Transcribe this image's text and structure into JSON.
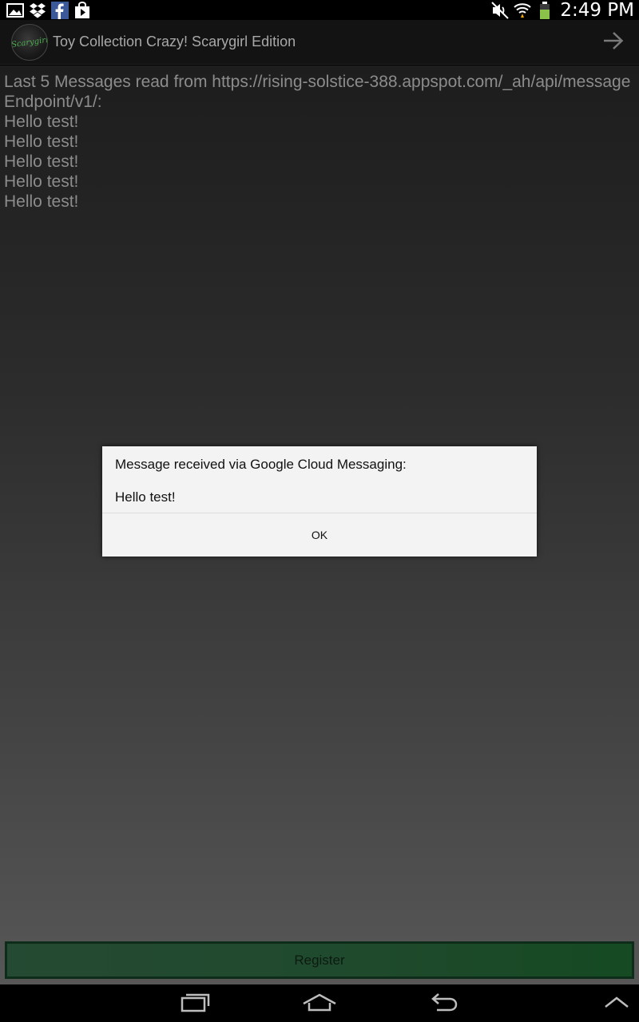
{
  "status_bar": {
    "left_icons": [
      "gallery-icon",
      "dropbox-icon",
      "facebook-icon",
      "play-store-icon"
    ],
    "right_icons": [
      "mute-icon",
      "wifi-icon",
      "battery-icon"
    ],
    "time": "2:49 PM"
  },
  "action_bar": {
    "logo_text": "Scarygirl",
    "title": "Toy Collection Crazy! Scarygirl Edition",
    "forward_icon": "arrow-right-icon"
  },
  "messages": {
    "header": "Last 5 Messages read from https://rising-solstice-388.appspot.com/_ah/api/messageEndpoint/v1/:",
    "items": [
      "Hello test!",
      "Hello test!",
      "Hello test!",
      "Hello test!",
      "Hello test!"
    ]
  },
  "register_button": {
    "label": "Register"
  },
  "dialog": {
    "message": "Message received via Google Cloud Messaging:",
    "body": "Hello test!",
    "ok_label": "OK"
  },
  "nav_bar": {
    "icons": [
      "recent-apps-icon",
      "home-icon",
      "back-icon",
      "menu-up-icon"
    ]
  },
  "colors": {
    "accent_green": "#1f4a2c",
    "dialog_bg": "#f3f3f3",
    "message_text": "#8c8c8c"
  }
}
